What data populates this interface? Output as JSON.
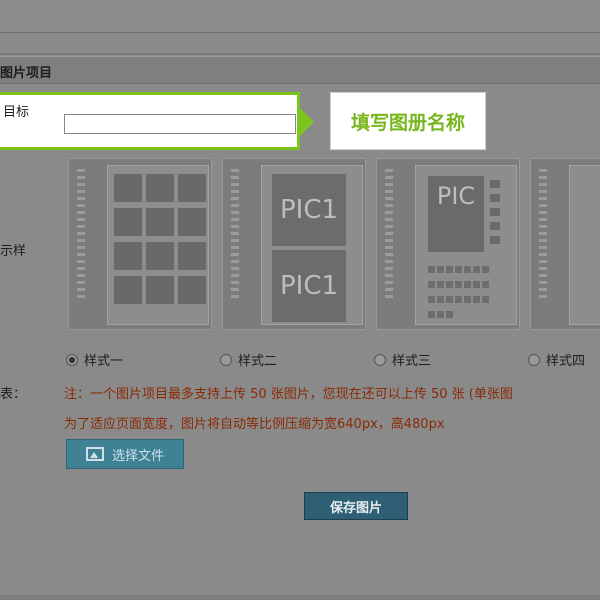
{
  "section": {
    "title": "图片项目"
  },
  "form": {
    "title_label": "目标",
    "title_value": "",
    "hint": "填写图册名称",
    "style_label": "示样",
    "upload_label": "表："
  },
  "styles": {
    "options": [
      "样式一",
      "样式二",
      "样式三",
      "样式四"
    ],
    "selected": "样式一",
    "pic_labels": [
      "PIC1",
      "PIC1",
      "PIC"
    ]
  },
  "notice": {
    "line1": "注：一个图片项目最多支持上传 50 张图片，您现在还可以上传 50 张 (单张图",
    "line2": "为了适应页面宽度，图片将自动等比例压缩为宽640px，高480px"
  },
  "buttons": {
    "choose_file": "选择文件",
    "save": "保存图片"
  },
  "colors": {
    "highlight": "#7cc31e",
    "hint_text": "#78b61d",
    "notice_text": "#8a2a05",
    "choose_btn": "#3f8296",
    "save_btn": "#2e5f74"
  }
}
